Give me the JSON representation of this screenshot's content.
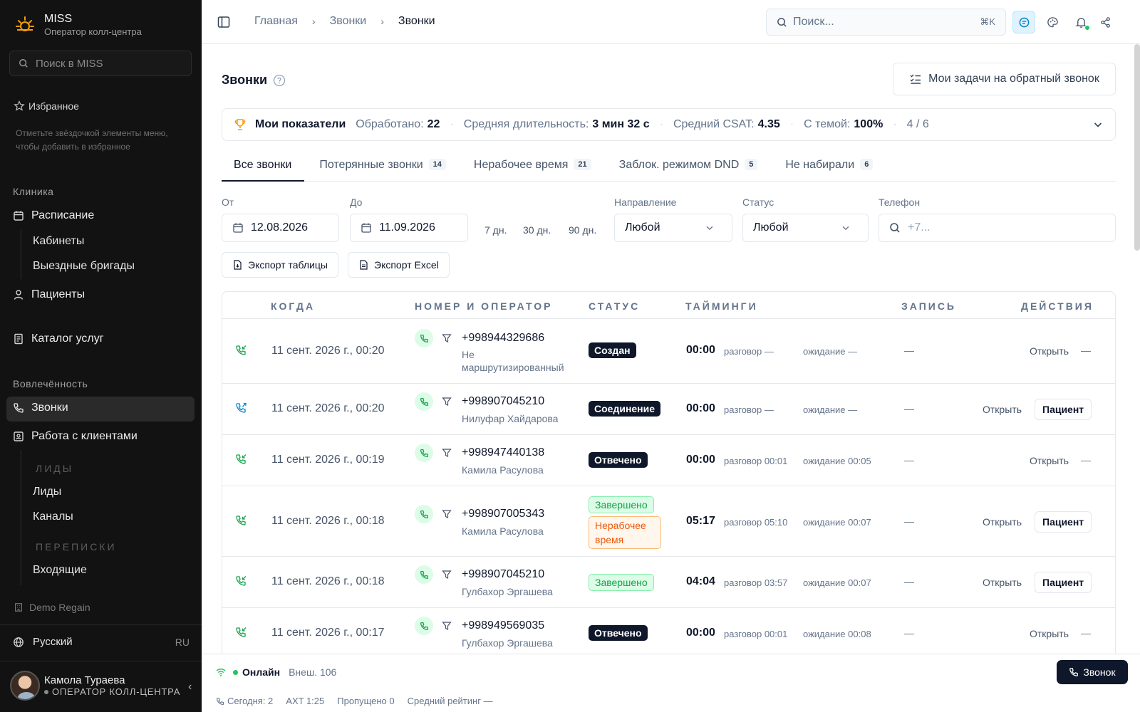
{
  "sidebar": {
    "app_name": "MISS",
    "app_role": "Оператор колл-центра",
    "search_placeholder": "Поиск в MISS",
    "favorites_title": "Избранное",
    "favorites_hint": "Отметьте звёздочкой элементы меню, чтобы добавить в избранное",
    "section_clinic": "Клиника",
    "schedule": "Расписание",
    "cabinets": "Кабинеты",
    "field_teams": "Выездные бригады",
    "patients": "Пациенты",
    "catalog": "Каталог услуг",
    "section_engagement": "Вовлечённость",
    "calls": "Звонки",
    "clients": "Работа с клиентами",
    "group_leads": "ЛИДЫ",
    "leads": "Лиды",
    "channels": "Каналы",
    "group_chats": "ПЕРЕПИСКИ",
    "inbox": "Входящие",
    "region": "Demo Regain",
    "language": "Русский",
    "language_code": "RU",
    "user_name": "Камола Тураева",
    "user_role": "ОПЕРАТОР КОЛЛ-ЦЕНТРА"
  },
  "topbar": {
    "crumbs": [
      "Главная",
      "Звонки",
      "Звонки"
    ],
    "search_placeholder": "Поиск...",
    "search_kbd": "⌘K"
  },
  "page": {
    "title": "Звонки",
    "tasks_button": "Мои задачи на обратный звонок"
  },
  "kpi": {
    "label": "Мои показатели",
    "processed_label": "Обработано:",
    "processed": "22",
    "duration_label": "Средняя длительность:",
    "duration": "3 мин 32 с",
    "csat_label": "Средний CSAT:",
    "csat": "4.35",
    "topic_label": "С темой:",
    "topic": "100%",
    "page": "4 / 6"
  },
  "tabs": [
    {
      "label": "Все звонки",
      "count": ""
    },
    {
      "label": "Потерянные звонки",
      "count": "14"
    },
    {
      "label": "Нерабочее время",
      "count": "21"
    },
    {
      "label": "Заблок. режимом DND",
      "count": "5"
    },
    {
      "label": "Не набирали",
      "count": "6"
    }
  ],
  "filters": {
    "from_label": "От",
    "from_value": "12.08.2026",
    "to_label": "До",
    "to_value": "11.09.2026",
    "quick": [
      "7 дн.",
      "30 дн.",
      "90 дн."
    ],
    "direction_label": "Направление",
    "direction_value": "Любой",
    "status_label": "Статус",
    "status_value": "Любой",
    "phone_label": "Телефон",
    "phone_placeholder": "+7...",
    "export_table": "Экспорт таблицы",
    "export_excel": "Экспорт Excel"
  },
  "table": {
    "headers": [
      "КОГДА",
      "НОМЕР И ОПЕРАТОР",
      "СТАТУС",
      "ТАЙМИНГИ",
      "ЗАПИСЬ",
      "ДЕЙСТВИЯ"
    ],
    "talk_label": "разговор",
    "wait_label": "ожидание",
    "open_label": "Открыть",
    "patient_label": "Пациент",
    "rows": [
      {
        "when": "11 сент. 2026 г., 00:20",
        "number": "+998944329686",
        "operator": "Не маршрутизированный",
        "status": "Создан",
        "status2": "",
        "total": "00:00",
        "talk": "—",
        "wait": "—",
        "record": "—",
        "patient": false
      },
      {
        "when": "11 сент. 2026 г., 00:20",
        "number": "+998907045210",
        "operator": "Нилуфар Хайдарова",
        "status": "Соединение",
        "status2": "",
        "total": "00:00",
        "talk": "—",
        "wait": "—",
        "record": "—",
        "patient": true
      },
      {
        "when": "11 сент. 2026 г., 00:19",
        "number": "+998947440138",
        "operator": "Камила Расулова",
        "status": "Отвечено",
        "status2": "",
        "total": "00:00",
        "talk": "00:01",
        "wait": "00:05",
        "record": "—",
        "patient": false
      },
      {
        "when": "11 сент. 2026 г., 00:18",
        "number": "+998907005343",
        "operator": "Камила Расулова",
        "status": "Завершено",
        "status2": "Нерабочее время",
        "total": "05:17",
        "talk": "05:10",
        "wait": "00:07",
        "record": "—",
        "patient": true
      },
      {
        "when": "11 сент. 2026 г., 00:18",
        "number": "+998907045210",
        "operator": "Гулбахор Эргашева",
        "status": "Завершено",
        "status2": "",
        "total": "04:04",
        "talk": "03:57",
        "wait": "00:07",
        "record": "—",
        "patient": true
      },
      {
        "when": "11 сент. 2026 г., 00:17",
        "number": "+998949569035",
        "operator": "Гулбахор Эргашева",
        "status": "Отвечено",
        "status2": "",
        "total": "00:00",
        "talk": "00:01",
        "wait": "00:08",
        "record": "—",
        "patient": false
      }
    ]
  },
  "footer": {
    "online": "Онлайн",
    "ext": "Внеш. 106",
    "call_button": "Звонок",
    "today": "Сегодня: 2",
    "axt": "AXT 1:25",
    "missed": "Пропущено 0",
    "rating": "Средний рейтинг —"
  },
  "colors": {
    "sidebar_bg": "#121212",
    "accent_green": "#22c55e",
    "badge_dark": "#0f172a"
  }
}
